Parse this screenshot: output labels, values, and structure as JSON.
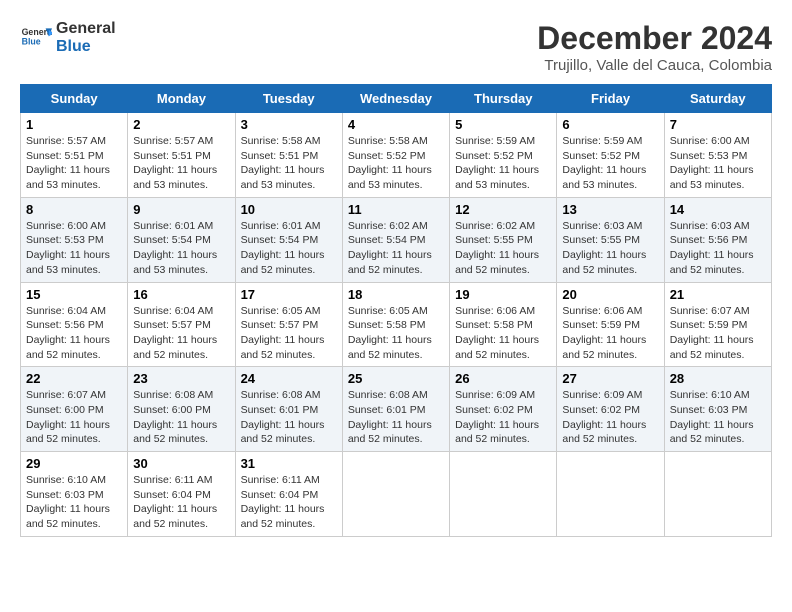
{
  "header": {
    "logo_line1": "General",
    "logo_line2": "Blue",
    "month_year": "December 2024",
    "location": "Trujillo, Valle del Cauca, Colombia"
  },
  "weekdays": [
    "Sunday",
    "Monday",
    "Tuesday",
    "Wednesday",
    "Thursday",
    "Friday",
    "Saturday"
  ],
  "weeks": [
    [
      {
        "day": 1,
        "sunrise": "5:57 AM",
        "sunset": "5:51 PM",
        "daylight": "11 hours and 53 minutes"
      },
      {
        "day": 2,
        "sunrise": "5:57 AM",
        "sunset": "5:51 PM",
        "daylight": "11 hours and 53 minutes"
      },
      {
        "day": 3,
        "sunrise": "5:58 AM",
        "sunset": "5:51 PM",
        "daylight": "11 hours and 53 minutes"
      },
      {
        "day": 4,
        "sunrise": "5:58 AM",
        "sunset": "5:52 PM",
        "daylight": "11 hours and 53 minutes"
      },
      {
        "day": 5,
        "sunrise": "5:59 AM",
        "sunset": "5:52 PM",
        "daylight": "11 hours and 53 minutes"
      },
      {
        "day": 6,
        "sunrise": "5:59 AM",
        "sunset": "5:52 PM",
        "daylight": "11 hours and 53 minutes"
      },
      {
        "day": 7,
        "sunrise": "6:00 AM",
        "sunset": "5:53 PM",
        "daylight": "11 hours and 53 minutes"
      }
    ],
    [
      {
        "day": 8,
        "sunrise": "6:00 AM",
        "sunset": "5:53 PM",
        "daylight": "11 hours and 53 minutes"
      },
      {
        "day": 9,
        "sunrise": "6:01 AM",
        "sunset": "5:54 PM",
        "daylight": "11 hours and 53 minutes"
      },
      {
        "day": 10,
        "sunrise": "6:01 AM",
        "sunset": "5:54 PM",
        "daylight": "11 hours and 52 minutes"
      },
      {
        "day": 11,
        "sunrise": "6:02 AM",
        "sunset": "5:54 PM",
        "daylight": "11 hours and 52 minutes"
      },
      {
        "day": 12,
        "sunrise": "6:02 AM",
        "sunset": "5:55 PM",
        "daylight": "11 hours and 52 minutes"
      },
      {
        "day": 13,
        "sunrise": "6:03 AM",
        "sunset": "5:55 PM",
        "daylight": "11 hours and 52 minutes"
      },
      {
        "day": 14,
        "sunrise": "6:03 AM",
        "sunset": "5:56 PM",
        "daylight": "11 hours and 52 minutes"
      }
    ],
    [
      {
        "day": 15,
        "sunrise": "6:04 AM",
        "sunset": "5:56 PM",
        "daylight": "11 hours and 52 minutes"
      },
      {
        "day": 16,
        "sunrise": "6:04 AM",
        "sunset": "5:57 PM",
        "daylight": "11 hours and 52 minutes"
      },
      {
        "day": 17,
        "sunrise": "6:05 AM",
        "sunset": "5:57 PM",
        "daylight": "11 hours and 52 minutes"
      },
      {
        "day": 18,
        "sunrise": "6:05 AM",
        "sunset": "5:58 PM",
        "daylight": "11 hours and 52 minutes"
      },
      {
        "day": 19,
        "sunrise": "6:06 AM",
        "sunset": "5:58 PM",
        "daylight": "11 hours and 52 minutes"
      },
      {
        "day": 20,
        "sunrise": "6:06 AM",
        "sunset": "5:59 PM",
        "daylight": "11 hours and 52 minutes"
      },
      {
        "day": 21,
        "sunrise": "6:07 AM",
        "sunset": "5:59 PM",
        "daylight": "11 hours and 52 minutes"
      }
    ],
    [
      {
        "day": 22,
        "sunrise": "6:07 AM",
        "sunset": "6:00 PM",
        "daylight": "11 hours and 52 minutes"
      },
      {
        "day": 23,
        "sunrise": "6:08 AM",
        "sunset": "6:00 PM",
        "daylight": "11 hours and 52 minutes"
      },
      {
        "day": 24,
        "sunrise": "6:08 AM",
        "sunset": "6:01 PM",
        "daylight": "11 hours and 52 minutes"
      },
      {
        "day": 25,
        "sunrise": "6:08 AM",
        "sunset": "6:01 PM",
        "daylight": "11 hours and 52 minutes"
      },
      {
        "day": 26,
        "sunrise": "6:09 AM",
        "sunset": "6:02 PM",
        "daylight": "11 hours and 52 minutes"
      },
      {
        "day": 27,
        "sunrise": "6:09 AM",
        "sunset": "6:02 PM",
        "daylight": "11 hours and 52 minutes"
      },
      {
        "day": 28,
        "sunrise": "6:10 AM",
        "sunset": "6:03 PM",
        "daylight": "11 hours and 52 minutes"
      }
    ],
    [
      {
        "day": 29,
        "sunrise": "6:10 AM",
        "sunset": "6:03 PM",
        "daylight": "11 hours and 52 minutes"
      },
      {
        "day": 30,
        "sunrise": "6:11 AM",
        "sunset": "6:04 PM",
        "daylight": "11 hours and 52 minutes"
      },
      {
        "day": 31,
        "sunrise": "6:11 AM",
        "sunset": "6:04 PM",
        "daylight": "11 hours and 52 minutes"
      },
      null,
      null,
      null,
      null
    ]
  ]
}
